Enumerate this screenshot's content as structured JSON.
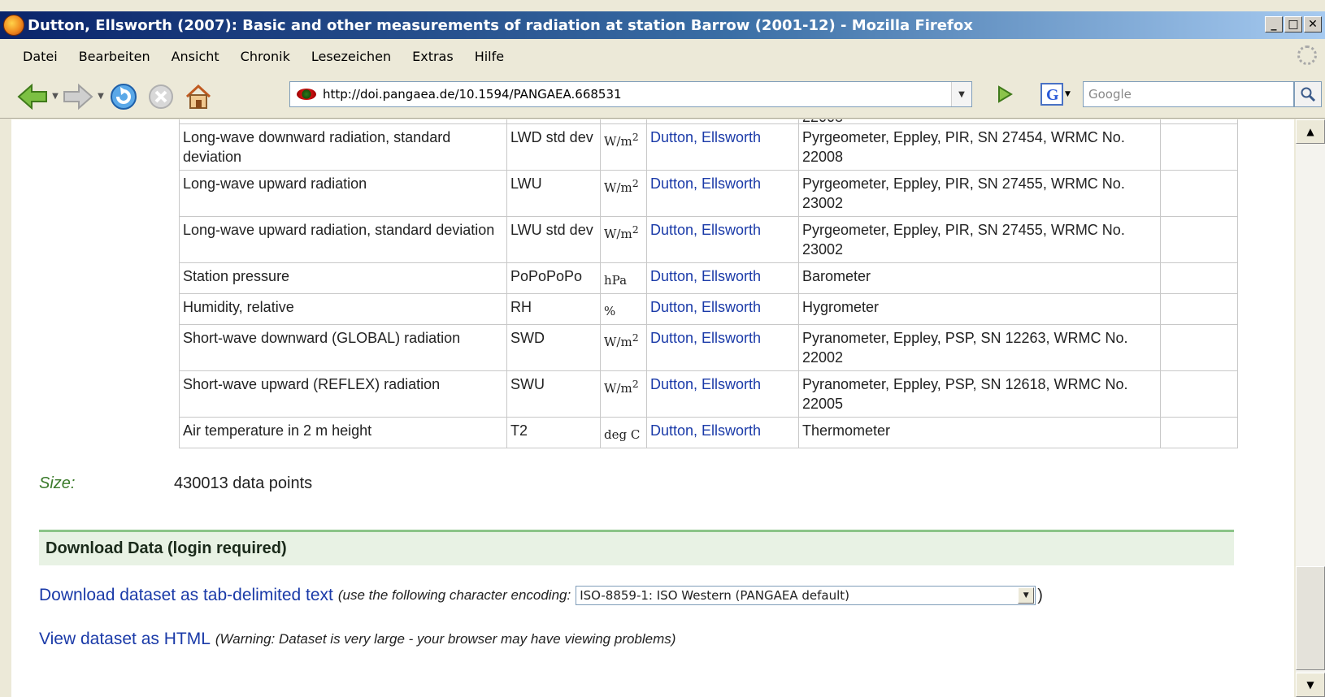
{
  "window": {
    "title": "Dutton, Ellsworth (2007): Basic and other measurements of radiation at station Barrow (2001-12) - Mozilla Firefox",
    "minimize": "_",
    "maximize": "□",
    "close": "✕"
  },
  "menu": [
    "Datei",
    "Bearbeiten",
    "Ansicht",
    "Chronik",
    "Lesezeichen",
    "Extras",
    "Hilfe"
  ],
  "nav": {
    "url": "http://doi.pangaea.de/10.1594/PANGAEA.668531",
    "search_placeholder": "Google",
    "icons": [
      "back-arrow-icon",
      "forward-arrow-icon",
      "reload-icon",
      "stop-icon",
      "home-icon",
      "go-arrow-icon",
      "google-search-engine-icon",
      "magnifier-icon"
    ]
  },
  "table": {
    "partial_top": "22008",
    "rows": [
      {
        "param": "Long-wave downward radiation, standard deviation",
        "short": "LWD std dev",
        "unit": "W/m",
        "sup": "2",
        "pi": "Dutton, Ellsworth",
        "method": "Pyrgeometer, Eppley, PIR, SN 27454, WRMC No. 22008",
        "comment": ""
      },
      {
        "param": "Long-wave upward radiation",
        "short": "LWU",
        "unit": "W/m",
        "sup": "2",
        "pi": "Dutton, Ellsworth",
        "method": "Pyrgeometer, Eppley, PIR, SN 27455, WRMC No. 23002",
        "comment": ""
      },
      {
        "param": "Long-wave upward radiation, standard deviation",
        "short": "LWU std dev",
        "unit": "W/m",
        "sup": "2",
        "pi": "Dutton, Ellsworth",
        "method": "Pyrgeometer, Eppley, PIR, SN 27455, WRMC No. 23002",
        "comment": ""
      },
      {
        "param": "Station pressure",
        "short": "PoPoPoPo",
        "unit": "hPa",
        "sup": "",
        "pi": "Dutton, Ellsworth",
        "method": "Barometer",
        "comment": ""
      },
      {
        "param": "Humidity, relative",
        "short": "RH",
        "unit": "%",
        "sup": "",
        "pi": "Dutton, Ellsworth",
        "method": "Hygrometer",
        "comment": ""
      },
      {
        "param": "Short-wave downward (GLOBAL) radiation",
        "short": "SWD",
        "unit": "W/m",
        "sup": "2",
        "pi": "Dutton, Ellsworth",
        "method": "Pyranometer, Eppley, PSP, SN 12263, WRMC No. 22002",
        "comment": ""
      },
      {
        "param": "Short-wave upward (REFLEX) radiation",
        "short": "SWU",
        "unit": "W/m",
        "sup": "2",
        "pi": "Dutton, Ellsworth",
        "method": "Pyranometer, Eppley, PSP, SN 12618, WRMC No. 22005",
        "comment": ""
      },
      {
        "param": "Air temperature in 2 m height",
        "short": "T2",
        "unit": "deg C",
        "sup": "",
        "pi": "Dutton, Ellsworth",
        "method": "Thermometer",
        "comment": ""
      }
    ]
  },
  "size": {
    "label": "Size:",
    "value": "430013 data points"
  },
  "download": {
    "header": "Download Data (login required)",
    "tab_link": "Download dataset as tab-delimited text",
    "tab_note": "(use the following character encoding:",
    "encoding_selected": "ISO-8859-1: ISO Western (PANGAEA default)",
    "close_paren": ")",
    "html_link": "View dataset as HTML",
    "html_note": "(Warning: Dataset is very large - your browser may have viewing problems)"
  }
}
